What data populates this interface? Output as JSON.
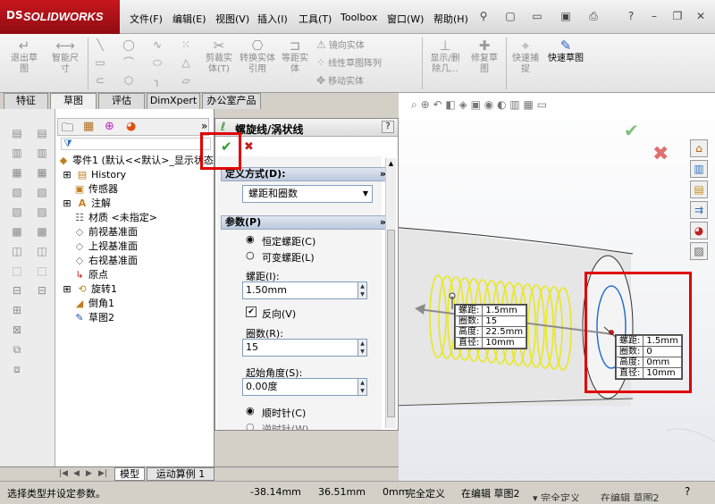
{
  "app": {
    "logo": "SOLIDWORKS",
    "logo_mark": "DS"
  },
  "menu": [
    "文件(F)",
    "编辑(E)",
    "视图(V)",
    "插入(I)",
    "工具(T)",
    "Toolbox",
    "窗口(W)",
    "帮助(H)"
  ],
  "commands": {
    "exit_sketch": "退出草图",
    "smart_dim": "智能尺寸",
    "trim": "剪裁实体(T)",
    "convert": "转换实体引用",
    "offset": "等距实体",
    "mirror": "镜向实体",
    "linear_pattern": "线性草图阵列",
    "move": "移动实体",
    "show_delete": "显示/删除几...",
    "repair": "修复草图",
    "quick_snap": "快速捕捉",
    "rapid_sketch": "快速草图"
  },
  "tabs": [
    "特征",
    "草图",
    "评估",
    "DimXpert",
    "办公室产品"
  ],
  "tree": {
    "root": "零件1  (默认<<默认>_显示状态",
    "items": [
      "History",
      "传感器",
      "注解",
      "材质 <未指定>",
      "前视基准面",
      "上视基准面",
      "右视基准面",
      "原点",
      "旋转1",
      "倒角1",
      "草图2"
    ]
  },
  "pm": {
    "title": "螺旋线/涡状线",
    "help": "?",
    "ok": "✔",
    "cancel": "✖",
    "define_group": "定义方式(D):",
    "define_value": "螺距和圈数",
    "params_group": "参数(P)",
    "const_pitch": "恒定螺距(C)",
    "var_pitch": "可变螺距(L)",
    "pitch_label": "螺距(I):",
    "pitch_value": "1.50mm",
    "reverse": "反向(V)",
    "turns_label": "圈数(R):",
    "turns_value": "15",
    "start_angle_label": "起始角度(S):",
    "start_angle_value": "0.00度",
    "clockwise": "顺时针(C)",
    "counterclockwise": "逆时针(W)"
  },
  "callout1": [
    [
      "螺距:",
      "1.5mm"
    ],
    [
      "圈数:",
      "15"
    ],
    [
      "高度:",
      "22.5mm"
    ],
    [
      "直径:",
      "10mm"
    ]
  ],
  "callout2": [
    [
      "螺距:",
      "1.5mm"
    ],
    [
      "圈数:",
      "0"
    ],
    [
      "高度:",
      "0mm"
    ],
    [
      "直径:",
      "10mm"
    ]
  ],
  "bottom_tabs": [
    "模型",
    "运动算例 1"
  ],
  "status": {
    "hint": "选择类型并设定参数。",
    "x": "-38.14mm",
    "y": "36.51mm",
    "z": "0mm",
    "defined": "完全定义",
    "editing": "在编辑 草图2",
    "defined2": "完全定义",
    "editing2": "在编辑 草图2"
  },
  "colors": {
    "accent_red": "#e00000",
    "helix": "#e8e820",
    "ok_green": "#2e9a2e"
  }
}
